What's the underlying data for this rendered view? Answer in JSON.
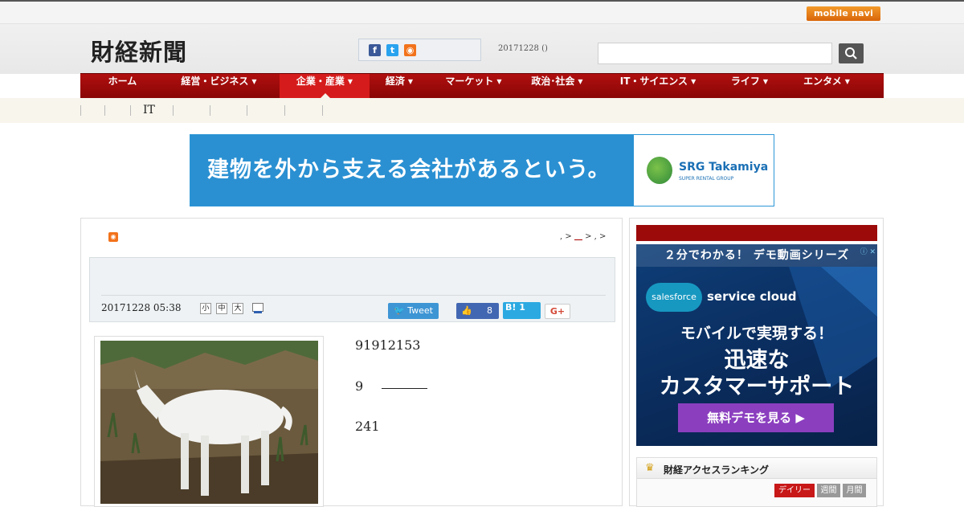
{
  "topbar": {
    "mobile_navi": "mobile navi"
  },
  "header": {
    "logo": "財経新聞",
    "date": "20171228 ()",
    "search_placeholder": ""
  },
  "social_icons": [
    "facebook-icon",
    "twitter-icon",
    "rss-icon"
  ],
  "nav": {
    "items": [
      {
        "label": "ホーム",
        "caret": false
      },
      {
        "label": "経営・ビジネス",
        "caret": true
      },
      {
        "label": "企業・産業",
        "caret": true,
        "active": true
      },
      {
        "label": "経済",
        "caret": true
      },
      {
        "label": "マーケット",
        "caret": true
      },
      {
        "label": "政治･社会",
        "caret": true
      },
      {
        "label": "IT・サイエンス",
        "caret": true
      },
      {
        "label": "ライフ",
        "caret": true
      },
      {
        "label": "エンタメ",
        "caret": true
      }
    ]
  },
  "subnav": {
    "it_label": "IT"
  },
  "banner": {
    "headline": "建物を外から支える会社があるという。",
    "brand": "SRG Takamiya",
    "brand_sub": "SUPER RENTAL GROUP"
  },
  "article": {
    "breadcrumb_prefix": ", >",
    "breadcrumb_suffix": " > , >",
    "date": "20171228 05:38",
    "font_sizes": [
      "小",
      "中",
      "大"
    ],
    "tweet_label": "Tweet",
    "like_count": "8",
    "hatena_label": "B! 1",
    "gplus_label": "G+",
    "paragraphs": [
      "91912153",
      "9",
      "241"
    ]
  },
  "sidebar_ad": {
    "top_bar": "２分でわかる！ デモ動画シリーズ",
    "salesforce": "salesforce",
    "service": "service cloud",
    "line1": "モバイルで実現する！",
    "line2": "迅速な",
    "line3": "カスタマーサポート",
    "cta": "無料デモを見る ▶"
  },
  "ranking": {
    "title": "財経アクセスランキング",
    "tabs": [
      "デイリー",
      "週間",
      "月間"
    ]
  },
  "colors": {
    "nav_red": "#9c0a0a",
    "nav_active": "#d51b1b",
    "banner_blue": "#2a90d2",
    "ad_purple": "#8b3fbf"
  }
}
